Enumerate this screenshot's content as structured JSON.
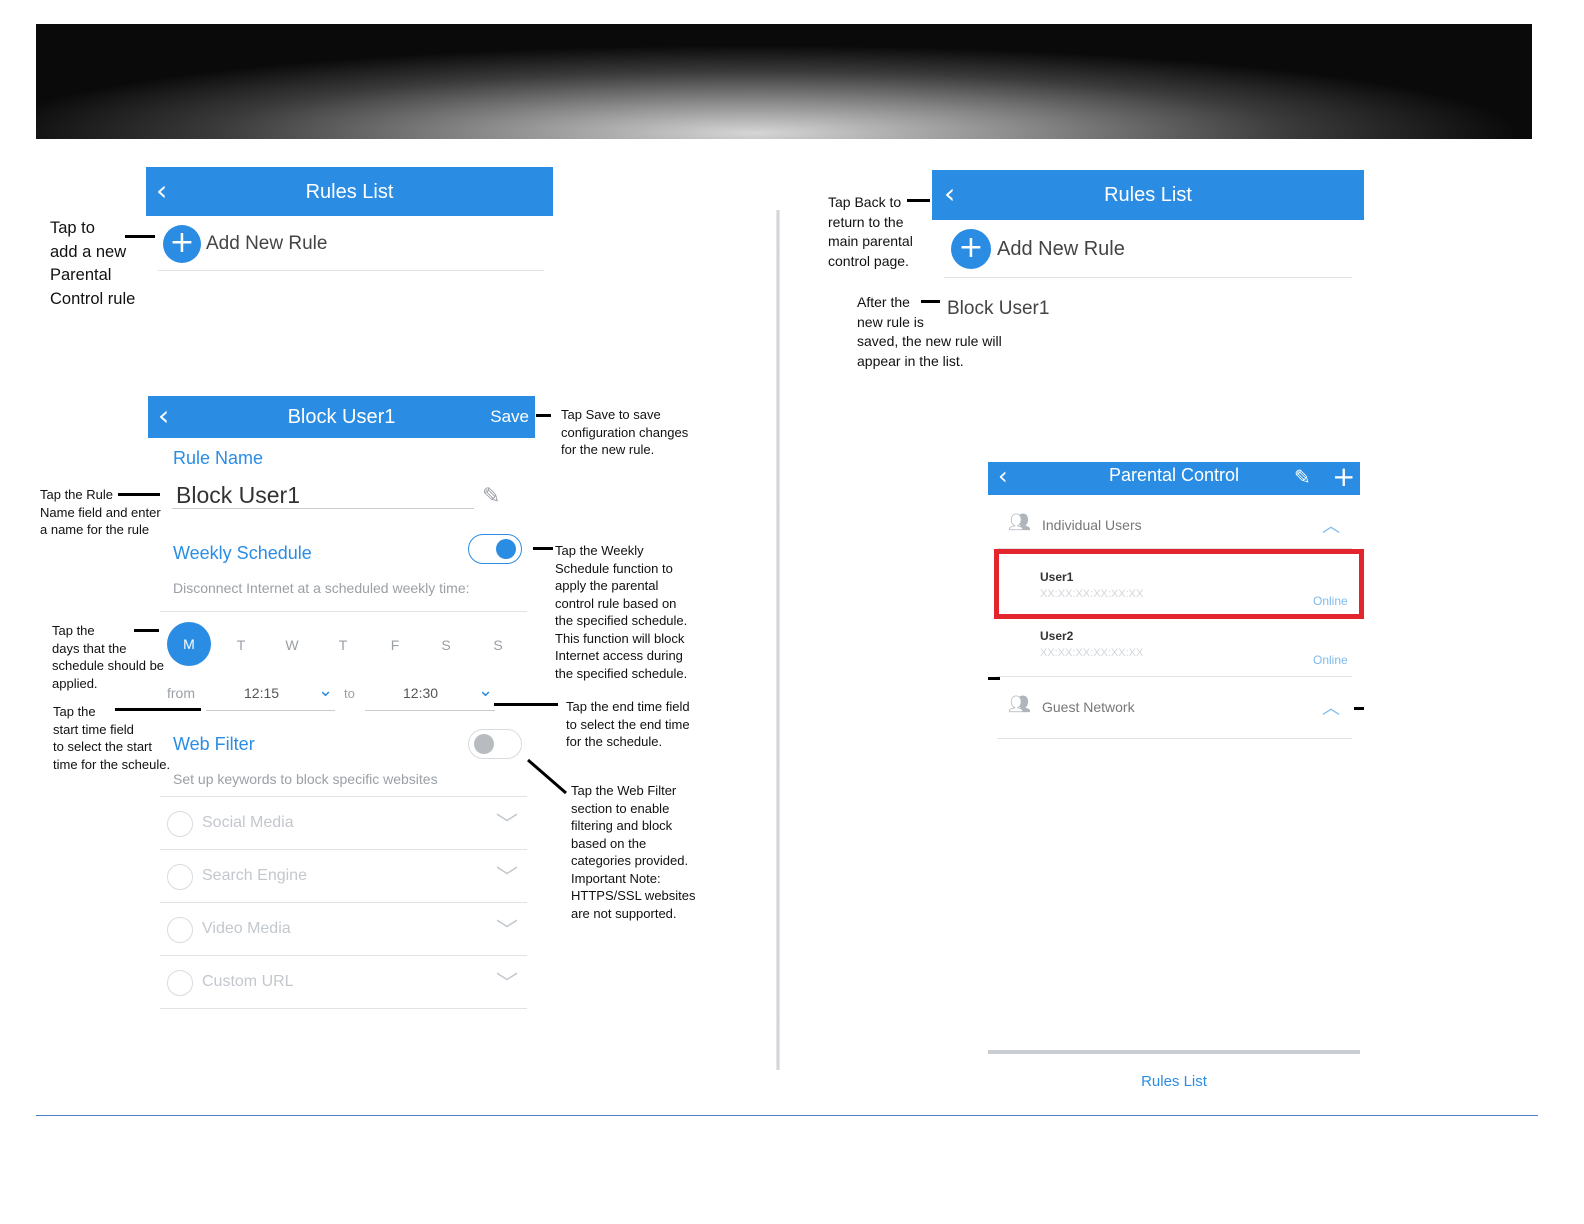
{
  "colors": {
    "accent": "#2a8de3",
    "highlight": "#e3262d"
  },
  "panel1": {
    "title": "Rules List",
    "add_label": "Add New Rule",
    "note_add": [
      "Tap to",
      "add a new",
      "Parental",
      "Control rule"
    ]
  },
  "panel2": {
    "title": "Block User1",
    "save_label": "Save",
    "rule_name_label": "Rule Name",
    "rule_name_value": "Block User1",
    "weekly_label": "Weekly Schedule",
    "weekly_enabled": true,
    "weekly_desc": "Disconnect Internet at a scheduled weekly time:",
    "days": [
      "M",
      "T",
      "W",
      "T",
      "F",
      "S",
      "S"
    ],
    "selected_day": "M",
    "from_label": "from",
    "from_time": "12:15",
    "to_label": "to",
    "to_time": "12:30",
    "web_filter_label": "Web Filter",
    "web_filter_enabled": false,
    "web_filter_desc": "Set up keywords to block specific websites",
    "categories": [
      "Social Media",
      "Search Engine",
      "Video Media",
      "Custom URL"
    ],
    "notes": {
      "save": [
        "Tap Save to save",
        "configuration changes",
        "for the new rule."
      ],
      "rule_name": [
        "Tap the Rule",
        "Name field and enter",
        "a name for the rule"
      ],
      "weekly": [
        "Tap the Weekly",
        "Schedule function to",
        "apply the parental",
        "control rule based on",
        "the specified schedule.",
        "This function will block",
        "Internet access during",
        "the specified schedule."
      ],
      "days": [
        "Tap the",
        "days that the",
        "schedule should be",
        "applied."
      ],
      "start": [
        "Tap the",
        "start time field",
        "to select the start",
        "time for the scheule."
      ],
      "end": [
        "Tap the end time field",
        "to select the end time",
        "for the schedule."
      ],
      "web_filter": [
        "Tap the Web Filter",
        "section to enable",
        "filtering and block",
        "based on the",
        "categories provided.",
        "Important Note:",
        "HTTPS/SSL websites",
        "are not supported."
      ]
    }
  },
  "panel3": {
    "title": "Rules List",
    "add_label": "Add New Rule",
    "rule_item": "Block User1",
    "note_back": [
      "Tap Back to",
      "return to the",
      "main parental",
      "control page."
    ],
    "note_saved": [
      "After the",
      "new rule is",
      "saved, the new rule will",
      "appear in the list."
    ]
  },
  "panel4": {
    "title": "Parental Control",
    "section1": "Individual Users",
    "users": [
      {
        "name": "User1",
        "mac": "XX:XX:XX:XX:XX:XX",
        "status": "Online"
      },
      {
        "name": "User2",
        "mac": "XX:XX:XX:XX:XX:XX",
        "status": "Online"
      }
    ],
    "section2": "Guest Network",
    "bottom_link": "Rules List"
  }
}
